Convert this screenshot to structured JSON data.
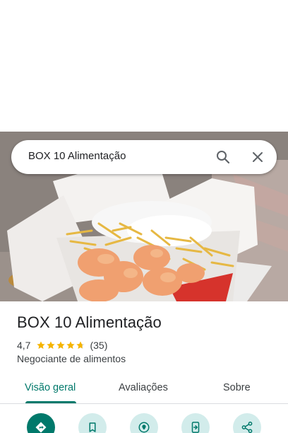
{
  "search": {
    "query": "BOX 10 Alimentação"
  },
  "place": {
    "name": "BOX 10 Alimentação",
    "rating": "4,7",
    "stars": 4.7,
    "review_count": "(35)",
    "category": "Negociante de alimentos"
  },
  "tabs": [
    {
      "label": "Visão geral",
      "active": true
    },
    {
      "label": "Avaliações",
      "active": false
    },
    {
      "label": "Sobre",
      "active": false
    }
  ],
  "actions": [
    {
      "icon": "directions-icon",
      "primary": true
    },
    {
      "icon": "bookmark-icon",
      "primary": false
    },
    {
      "icon": "nearby-icon",
      "primary": false
    },
    {
      "icon": "send-to-phone-icon",
      "primary": false
    },
    {
      "icon": "share-icon",
      "primary": false
    }
  ],
  "colors": {
    "accent": "#00796b",
    "action_bg": "#d2eceb",
    "star": "#f5b400"
  }
}
